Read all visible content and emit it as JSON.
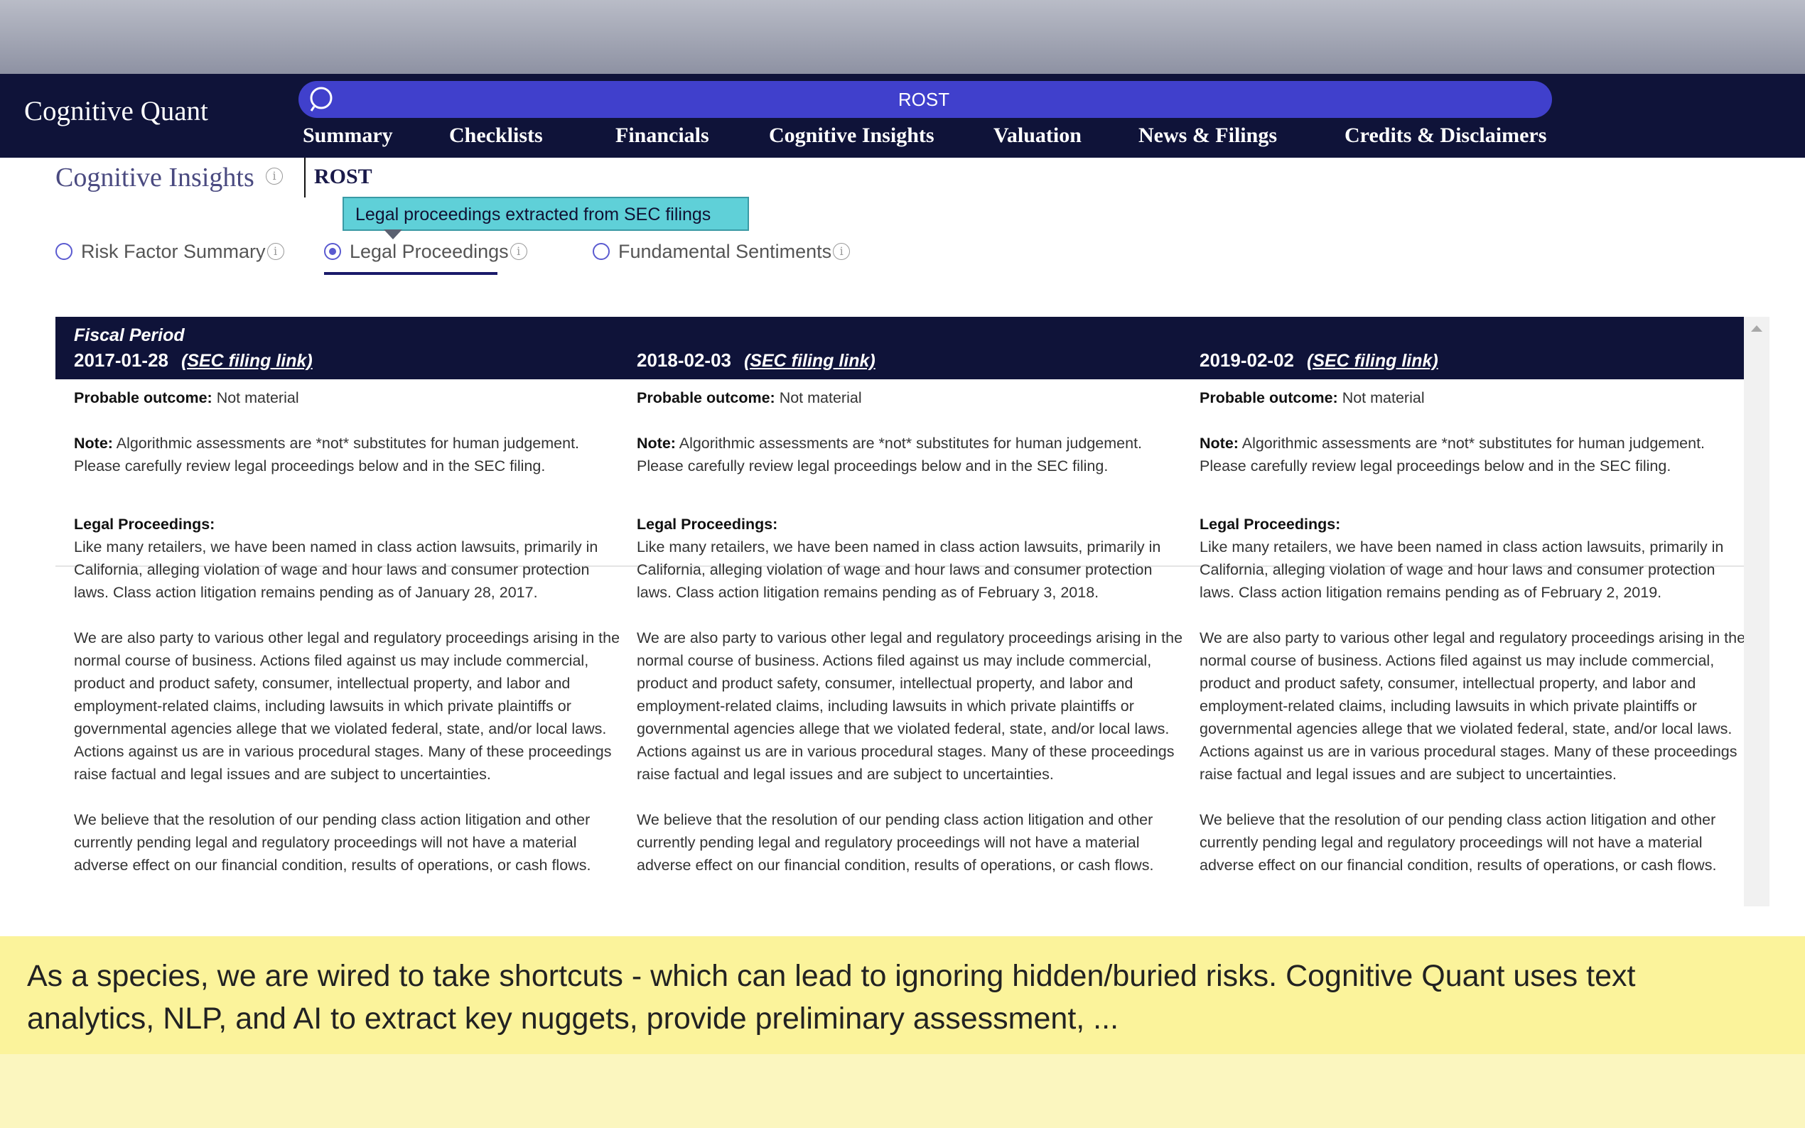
{
  "app": {
    "brand": "Cognitive Quant"
  },
  "search": {
    "value": "ROST",
    "icon": "search-icon"
  },
  "nav": {
    "tabs": [
      "Summary",
      "Checklists",
      "Financials",
      "Cognitive Insights",
      "Valuation",
      "News & Filings",
      "Credits & Disclaimers"
    ]
  },
  "page": {
    "title": "Cognitive Insights",
    "ticker": "ROST",
    "info_glyph": "i"
  },
  "tooltip": {
    "text": "Legal proceedings extracted from SEC filings"
  },
  "options": {
    "risk_factor": "Risk Factor Summary",
    "legal": "Legal Proceedings",
    "sentiments": "Fundamental Sentiments",
    "selected": "Legal Proceedings"
  },
  "table": {
    "fiscal_label": "Fiscal Period",
    "link_text": "(SEC filing link)",
    "outcome_label": "Probable outcome:",
    "note_label": "Note:",
    "legal_label": "Legal Proceedings:",
    "columns": [
      {
        "date": "2017-01-28",
        "outcome": "Not material",
        "note": "Algorithmic assessments are *not* substitutes for human judgement. Please carefully review legal proceedings below and in the SEC filing.",
        "p1": "Like many retailers, we have been named in class action lawsuits, primarily in California, alleging violation of wage and hour laws and consumer protection laws. Class action litigation remains pending as of January 28, 2017.",
        "p2": "We are also party to various other legal and regulatory proceedings arising in the normal course of business. Actions filed against us may include commercial, product and product safety, consumer, intellectual property, and labor and employment-related claims, including lawsuits in which private plaintiffs or governmental agencies allege that we violated federal, state, and/or local laws. Actions against us are in various procedural stages. Many of these proceedings raise factual and legal issues and are subject to uncertainties.",
        "p3": "We believe that the resolution of our pending class action litigation and other currently pending legal and regulatory proceedings will not have a material adverse effect on our financial condition, results of operations, or cash flows."
      },
      {
        "date": "2018-02-03",
        "outcome": "Not material",
        "note": "Algorithmic assessments are *not* substitutes for human judgement. Please carefully review legal proceedings below and in the SEC filing.",
        "p1": "Like many retailers, we have been named in class action lawsuits, primarily in California, alleging violation of wage and hour laws and consumer protection laws. Class action litigation remains pending as of February 3, 2018.",
        "p2": "We are also party to various other legal and regulatory proceedings arising in the normal course of business. Actions filed against us may include commercial, product and product safety, consumer, intellectual property, and labor and employment-related claims, including lawsuits in which private plaintiffs or governmental agencies allege that we violated federal, state, and/or local laws. Actions against us are in various procedural stages. Many of these proceedings raise factual and legal issues and are subject to uncertainties.",
        "p3": "We believe that the resolution of our pending class action litigation and other currently pending legal and regulatory proceedings will not have a material adverse effect on our financial condition, results of operations, or cash flows."
      },
      {
        "date": "2019-02-02",
        "outcome": "Not material",
        "note": "Algorithmic assessments are *not* substitutes for human judgement. Please carefully review legal proceedings below and in the SEC filing.",
        "p1": "Like many retailers, we have been named in class action lawsuits, primarily in California, alleging violation of wage and hour laws and consumer protection laws. Class action litigation remains pending as of February 2, 2019.",
        "p2": "We are also party to various other legal and regulatory proceedings arising in the normal course of business. Actions filed against us may include commercial, product and product safety, consumer, intellectual property, and labor and employment-related claims, including lawsuits in which private plaintiffs or governmental agencies allege that we violated federal, state, and/or local laws. Actions against us are in various procedural stages. Many of these proceedings raise factual and legal issues and are subject to uncertainties.",
        "p3": "We believe that the resolution of our pending class action litigation and other currently pending legal and regulatory proceedings will not have a material adverse effect on our financial condition, results of operations, or cash flows."
      }
    ]
  },
  "banner": {
    "text": "As a species, we are wired to take shortcuts - which can lead to ignoring hidden/buried risks. Cognitive Quant uses text analytics, NLP, and AI to extract key nuggets, provide preliminary assessment, ..."
  },
  "colors": {
    "nav_bg": "#0f1339",
    "search_bg": "#4040cc",
    "tooltip_bg": "#5fd0d8",
    "banner_bg": "#fbf39b",
    "accent": "#5a5ad0"
  }
}
